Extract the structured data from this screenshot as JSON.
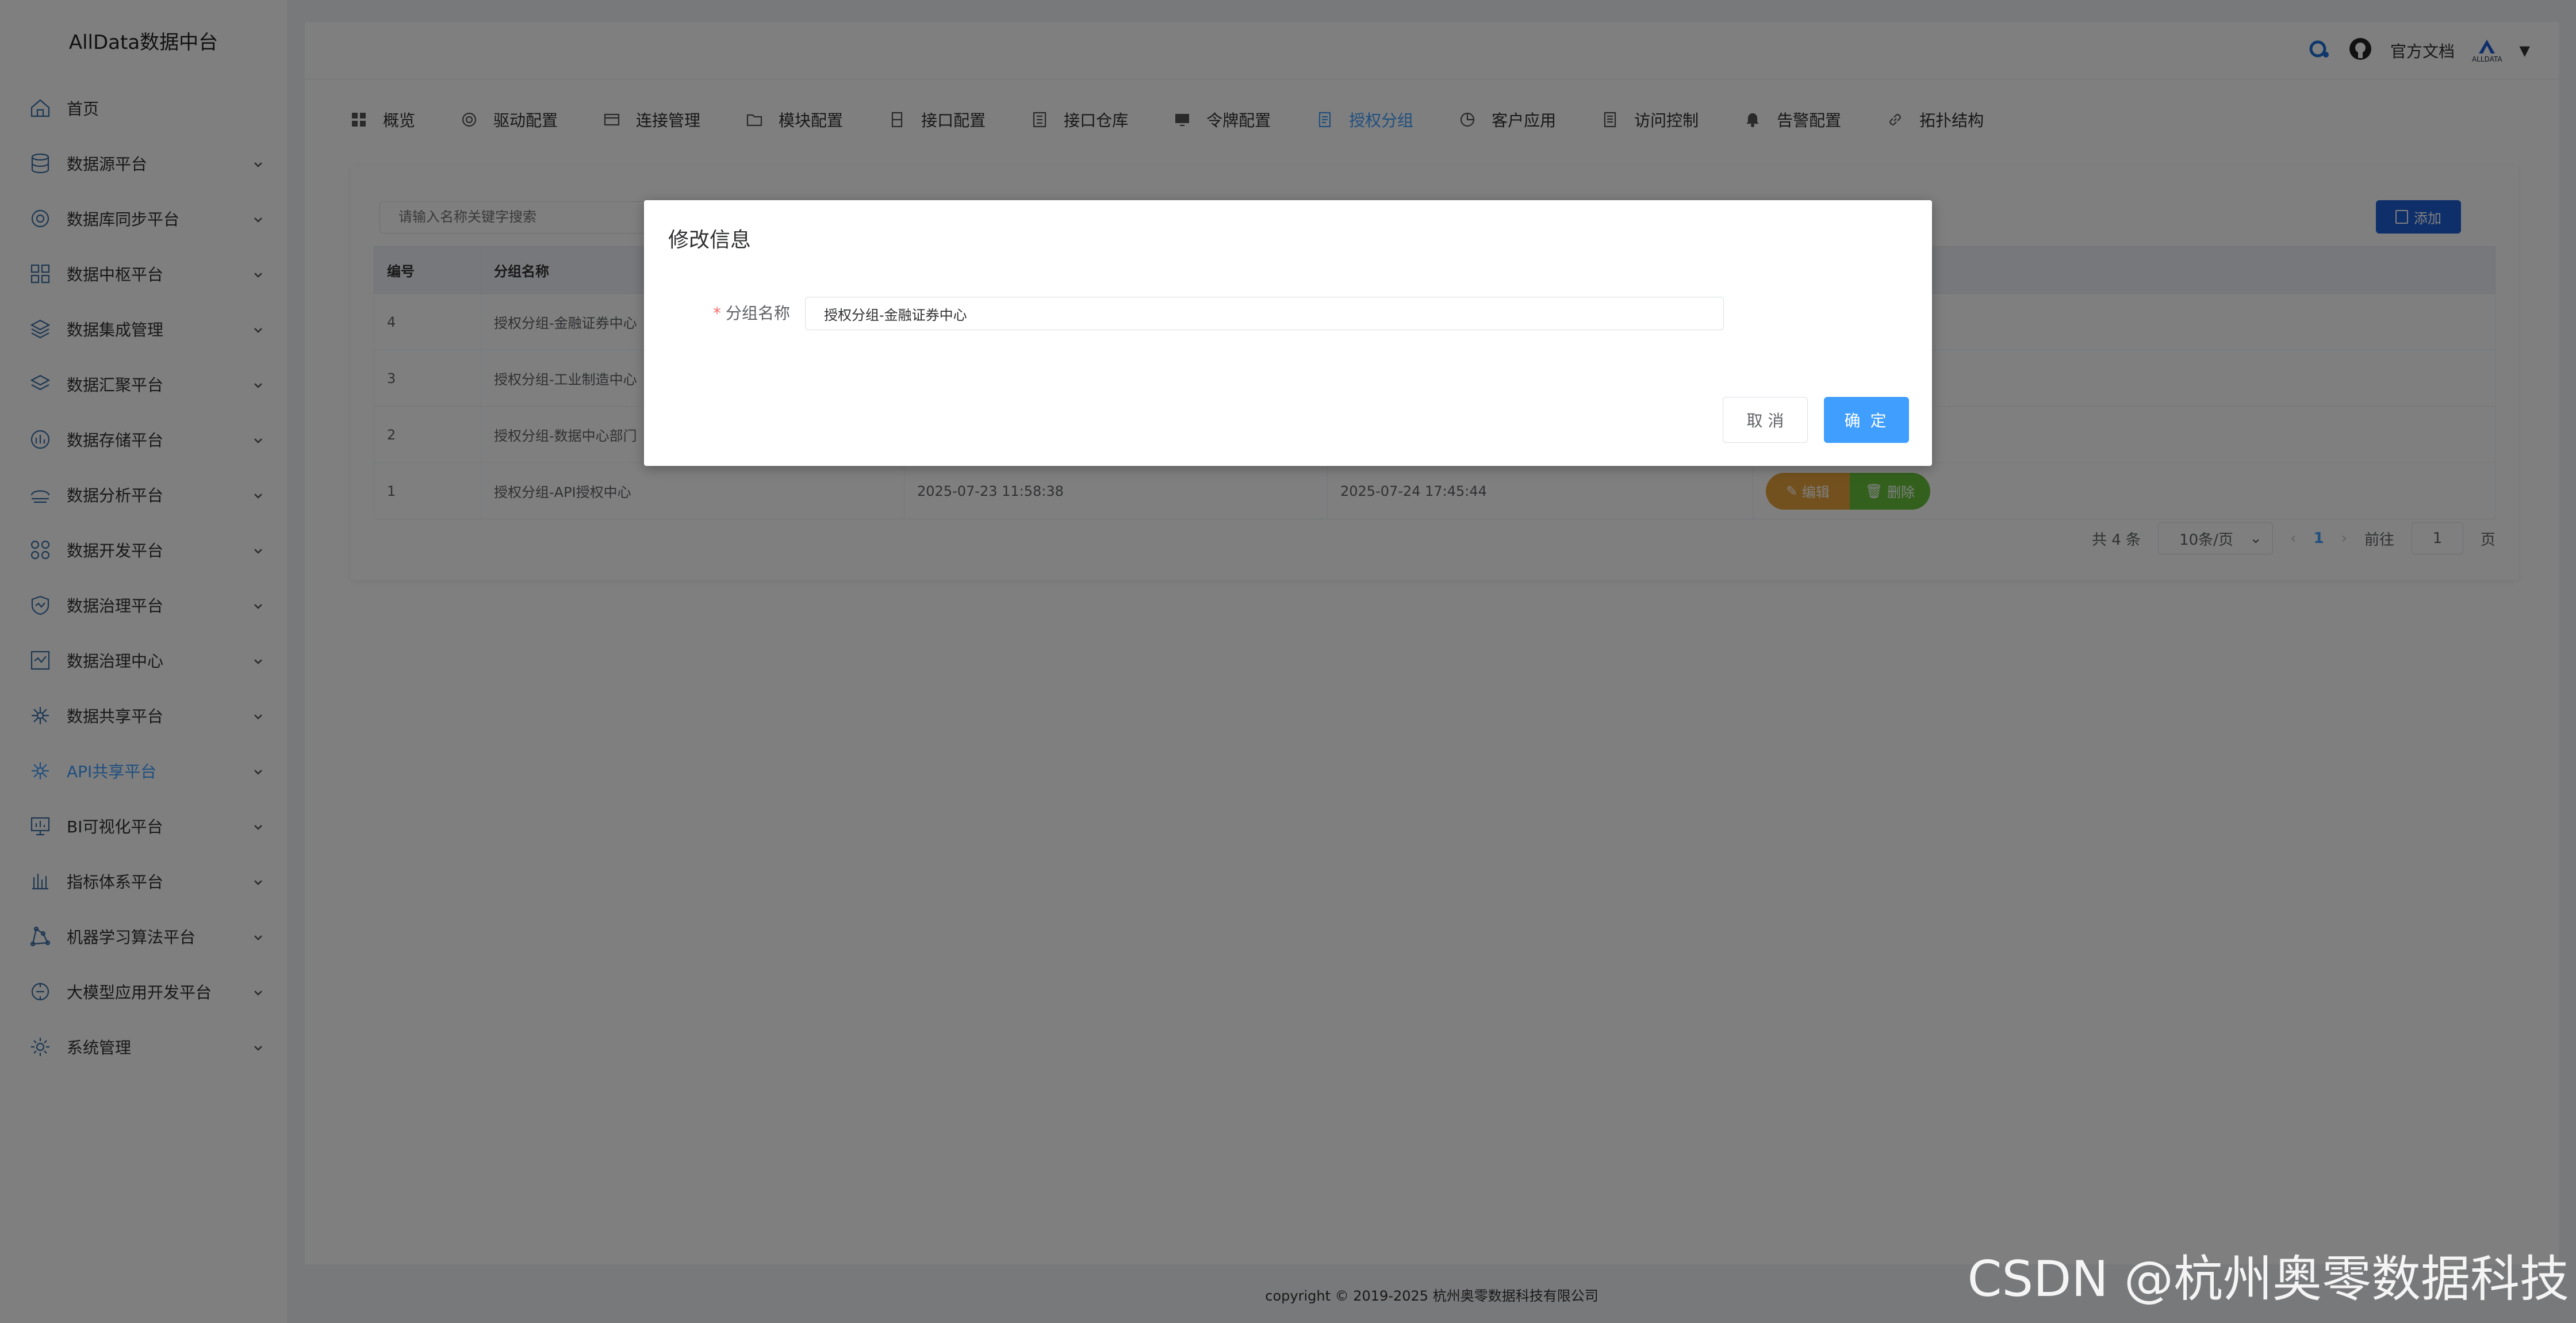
{
  "brand": "AllData数据中台",
  "sidebar": {
    "items": [
      {
        "label": "首页",
        "icon": "home-icon"
      },
      {
        "label": "数据源平台",
        "icon": "database-icon"
      },
      {
        "label": "数据库同步平台",
        "icon": "sync-icon"
      },
      {
        "label": "数据中枢平台",
        "icon": "hub-icon"
      },
      {
        "label": "数据集成管理",
        "icon": "layers-icon"
      },
      {
        "label": "数据汇聚平台",
        "icon": "stack-icon"
      },
      {
        "label": "数据存储平台",
        "icon": "storage-icon"
      },
      {
        "label": "数据分析平台",
        "icon": "analysis-icon"
      },
      {
        "label": "数据开发平台",
        "icon": "dev-icon"
      },
      {
        "label": "数据治理平台",
        "icon": "governance-icon"
      },
      {
        "label": "数据治理中心",
        "icon": "governance-center-icon"
      },
      {
        "label": "数据共享平台",
        "icon": "share-icon"
      },
      {
        "label": "API共享平台",
        "icon": "api-icon"
      },
      {
        "label": "BI可视化平台",
        "icon": "bi-icon"
      },
      {
        "label": "指标体系平台",
        "icon": "metrics-icon"
      },
      {
        "label": "机器学习算法平台",
        "icon": "ml-icon"
      },
      {
        "label": "大模型应用开发平台",
        "icon": "llm-icon"
      },
      {
        "label": "系统管理",
        "icon": "settings-icon"
      }
    ],
    "active_index": 12
  },
  "header": {
    "docs_label": "官方文档",
    "avatar_text": "ALLDATA"
  },
  "tabs": [
    {
      "label": "概览",
      "icon": "grid-icon"
    },
    {
      "label": "驱动配置",
      "icon": "driver-icon"
    },
    {
      "label": "连接管理",
      "icon": "connection-icon"
    },
    {
      "label": "模块配置",
      "icon": "folder-icon"
    },
    {
      "label": "接口配置",
      "icon": "interface-icon"
    },
    {
      "label": "接口仓库",
      "icon": "repository-icon"
    },
    {
      "label": "令牌配置",
      "icon": "token-icon"
    },
    {
      "label": "授权分组",
      "icon": "auth-group-icon"
    },
    {
      "label": "客户应用",
      "icon": "client-app-icon"
    },
    {
      "label": "访问控制",
      "icon": "access-control-icon"
    },
    {
      "label": "告警配置",
      "icon": "bell-icon"
    },
    {
      "label": "拓扑结构",
      "icon": "link-icon"
    }
  ],
  "active_tab": 7,
  "search": {
    "placeholder": "请输入名称关键字搜索"
  },
  "add_label": "添加",
  "table": {
    "columns": [
      "编号",
      "分组名称",
      "",
      "",
      ""
    ],
    "rows": [
      {
        "id": "4",
        "name": "授权分组-金融证券中心",
        "created": "",
        "updated": ""
      },
      {
        "id": "3",
        "name": "授权分组-工业制造中心",
        "created": "",
        "updated": ""
      },
      {
        "id": "2",
        "name": "授权分组-数据中心部门",
        "created": "",
        "updated": ""
      },
      {
        "id": "1",
        "name": "授权分组-API授权中心",
        "created": "2025-07-23 11:58:38",
        "updated": "2025-07-24 17:45:44"
      }
    ],
    "edit_label": "编辑",
    "delete_label": "删除"
  },
  "pagination": {
    "total": "共 4 条",
    "page_size": "10条/页",
    "current": "1",
    "goto_prefix": "前往",
    "goto_value": "1",
    "goto_suffix": "页"
  },
  "dialog": {
    "title": "修改信息",
    "field_label": "分组名称",
    "field_value": "授权分组-金融证券中心",
    "cancel_label": "取 消",
    "ok_label": "确 定"
  },
  "footer": "copyright © 2019-2025 杭州奥零数据科技有限公司",
  "watermark": "CSDN @杭州奥零数据科技"
}
